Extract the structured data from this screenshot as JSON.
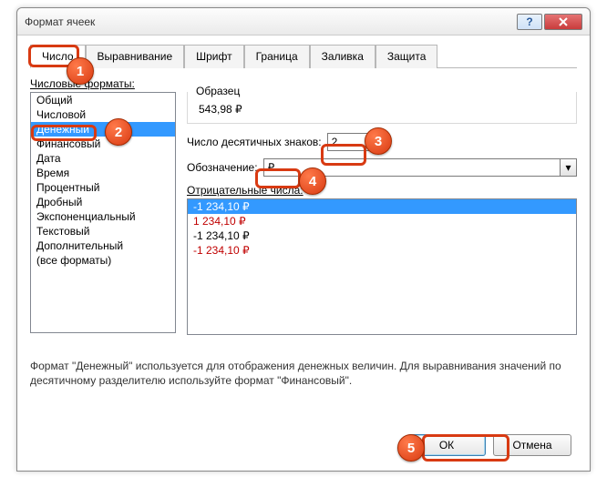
{
  "window": {
    "title": "Формат ячеек"
  },
  "tabs": [
    {
      "label": "Число",
      "active": true
    },
    {
      "label": "Выравнивание",
      "active": false
    },
    {
      "label": "Шрифт",
      "active": false
    },
    {
      "label": "Граница",
      "active": false
    },
    {
      "label": "Заливка",
      "active": false
    },
    {
      "label": "Защита",
      "active": false
    }
  ],
  "formatsLabel": "Числовые форматы:",
  "formats": [
    "Общий",
    "Числовой",
    "Денежный",
    "Финансовый",
    "Дата",
    "Время",
    "Процентный",
    "Дробный",
    "Экспоненциальный",
    "Текстовый",
    "Дополнительный",
    "(все форматы)"
  ],
  "formatsSelectedIndex": 2,
  "sample": {
    "label": "Образец",
    "value": "543,98 ₽"
  },
  "decimals": {
    "label": "Число десятичных знаков:",
    "value": "2"
  },
  "symbol": {
    "label": "Обозначение:",
    "value": "₽"
  },
  "negLabel": "Отрицательные числа:",
  "negatives": [
    {
      "text": "-1 234,10 ₽",
      "red": false,
      "selected": true
    },
    {
      "text": "1 234,10 ₽",
      "red": true,
      "selected": false
    },
    {
      "text": "-1 234,10 ₽",
      "red": false,
      "selected": false
    },
    {
      "text": "-1 234,10 ₽",
      "red": true,
      "selected": false
    }
  ],
  "description": "Формат \"Денежный\" используется для отображения денежных величин. Для выравнивания значений по десятичному разделителю используйте формат \"Финансовый\".",
  "buttons": {
    "ok": "ОК",
    "cancel": "Отмена"
  },
  "help": "?",
  "callouts": {
    "1": "1",
    "2": "2",
    "3": "3",
    "4": "4",
    "5": "5"
  }
}
